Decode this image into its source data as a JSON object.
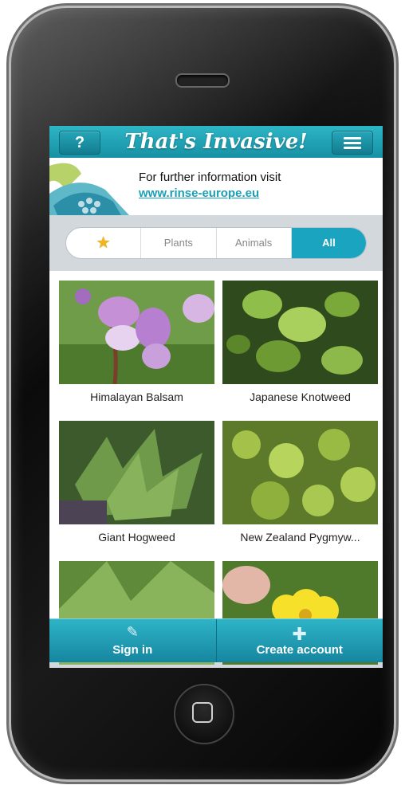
{
  "header": {
    "title": "That's Invasive!",
    "help_label": "?",
    "menu_icon": "menu-icon"
  },
  "banner": {
    "text": "For further information visit",
    "link": "www.rinse-europe.eu"
  },
  "filters": {
    "favorites_icon": "star-icon",
    "items": [
      "Plants",
      "Animals",
      "All"
    ],
    "active": "All"
  },
  "species": [
    {
      "name": "Himalayan Balsam"
    },
    {
      "name": "Japanese Knotweed"
    },
    {
      "name": "Giant Hogweed"
    },
    {
      "name": "New Zealand Pygmyw..."
    },
    {
      "name": ""
    },
    {
      "name": ""
    }
  ],
  "tabbar": {
    "sign_in": "Sign in",
    "create_account": "Create account"
  },
  "colors": {
    "accent": "#1aa4c0",
    "header": "#1f9fb2",
    "link": "#1aa0b6"
  }
}
